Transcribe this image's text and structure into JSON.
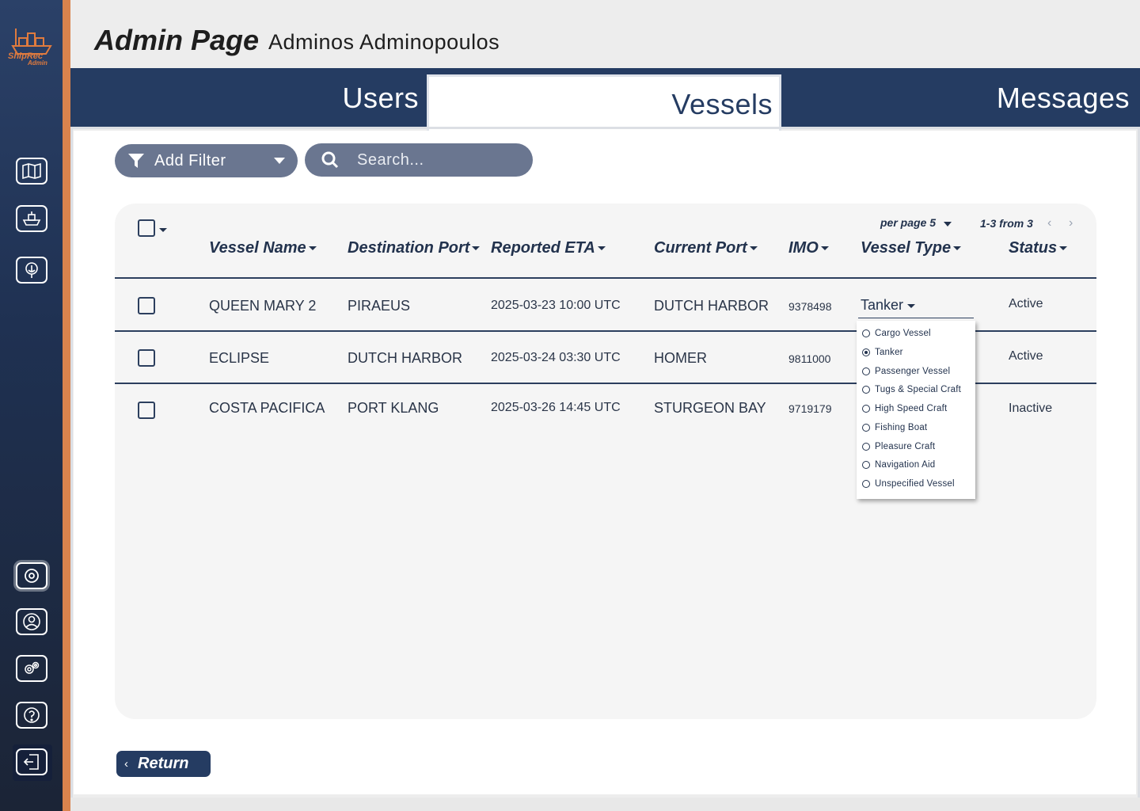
{
  "brand": {
    "name": "ShipRec",
    "sub": "Admin",
    "accent": "#d9834d",
    "navy": "#253c62"
  },
  "header": {
    "title": "Admin Page",
    "user": "Adminos Adminopoulos"
  },
  "tabs": [
    {
      "label": "Users",
      "active": false
    },
    {
      "label": "Vessels",
      "active": true
    },
    {
      "label": "Messages",
      "active": false
    }
  ],
  "sidebar": {
    "top_icons": [
      "map-icon",
      "ship-icon",
      "port-anchor-icon"
    ],
    "bottom_icons": [
      "admin-settings-icon",
      "profile-icon",
      "gears-icon",
      "help-icon",
      "logout-icon"
    ]
  },
  "toolbar": {
    "filter_label": "Add Filter",
    "search_placeholder": "Search..."
  },
  "table": {
    "columns": [
      "Vessel Name",
      "Destination Port",
      "Reported ETA",
      "Current Port",
      "IMO",
      "Vessel Type",
      "Status"
    ],
    "per_page_label": "per page",
    "per_page": "5",
    "range": "1-3 from 3",
    "rows": [
      {
        "name": "QUEEN MARY 2",
        "dest": "PIRAEUS",
        "eta": "2025-03-23 10:00 UTC",
        "current": "DUTCH HARBOR",
        "imo": "9378498",
        "type": "Tanker",
        "status": "Active"
      },
      {
        "name": "ECLIPSE",
        "dest": "DUTCH HARBOR",
        "eta": "2025-03-24 03:30 UTC",
        "current": "HOMER",
        "imo": "9811000",
        "type": "",
        "status": "Active"
      },
      {
        "name": "COSTA PACIFICA",
        "dest": "PORT KLANG",
        "eta": "2025-03-26 14:45 UTC",
        "current": "STURGEON BAY",
        "imo": "9719179",
        "type": "",
        "status": "Inactive"
      }
    ]
  },
  "type_dropdown": {
    "selected": "Tanker",
    "options": [
      "Cargo Vessel",
      "Tanker",
      "Passenger Vessel",
      "Tugs & Special Craft",
      "High Speed Craft",
      "Fishing Boat",
      "Pleasure Craft",
      "Navigation Aid",
      "Unspecified Vessel"
    ]
  },
  "footer": {
    "return_label": "Return"
  }
}
